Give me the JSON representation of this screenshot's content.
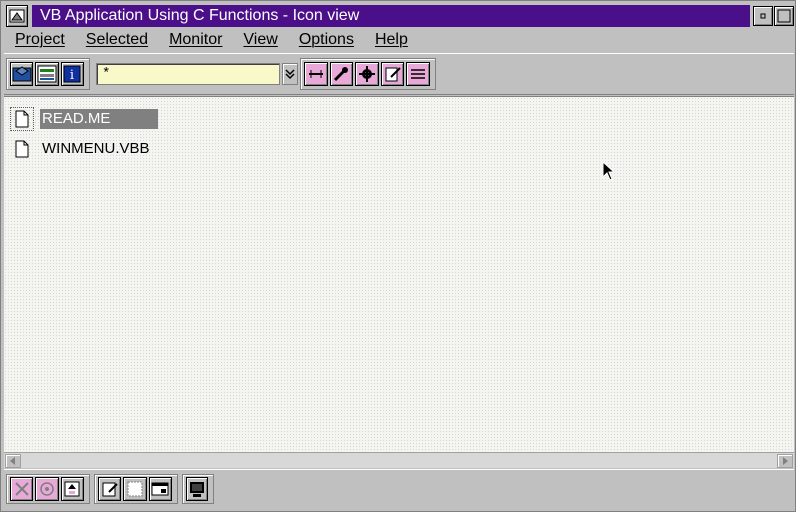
{
  "window": {
    "title": "VB Application Using C Functions - Icon view"
  },
  "menu": {
    "items": [
      {
        "label": "Project"
      },
      {
        "label": "Selected"
      },
      {
        "label": "Monitor"
      },
      {
        "label": "View"
      },
      {
        "label": "Options"
      },
      {
        "label": "Help"
      }
    ]
  },
  "toolbar": {
    "filter_value": "*",
    "left_buttons": [
      "open-folder-icon",
      "tree-icon",
      "info-icon"
    ],
    "right_buttons": [
      "build-icon",
      "wrench-icon",
      "gear-icon",
      "edit-icon",
      "list-icon"
    ]
  },
  "files": [
    {
      "name": "READ.ME",
      "selected": true
    },
    {
      "name": "WINMENU.VBB",
      "selected": false
    }
  ],
  "bottom_toolbar": {
    "buttons": [
      "tools-icon",
      "view-icon",
      "sort-icon",
      "notepad-icon",
      "window-icon",
      "monitor-icon",
      "terminal-icon"
    ]
  },
  "colors": {
    "title_bar": "#4b0f8a",
    "filter_bg": "#f8f8c8",
    "selection": "#808080",
    "tool_pink": "#e8a8d8"
  }
}
